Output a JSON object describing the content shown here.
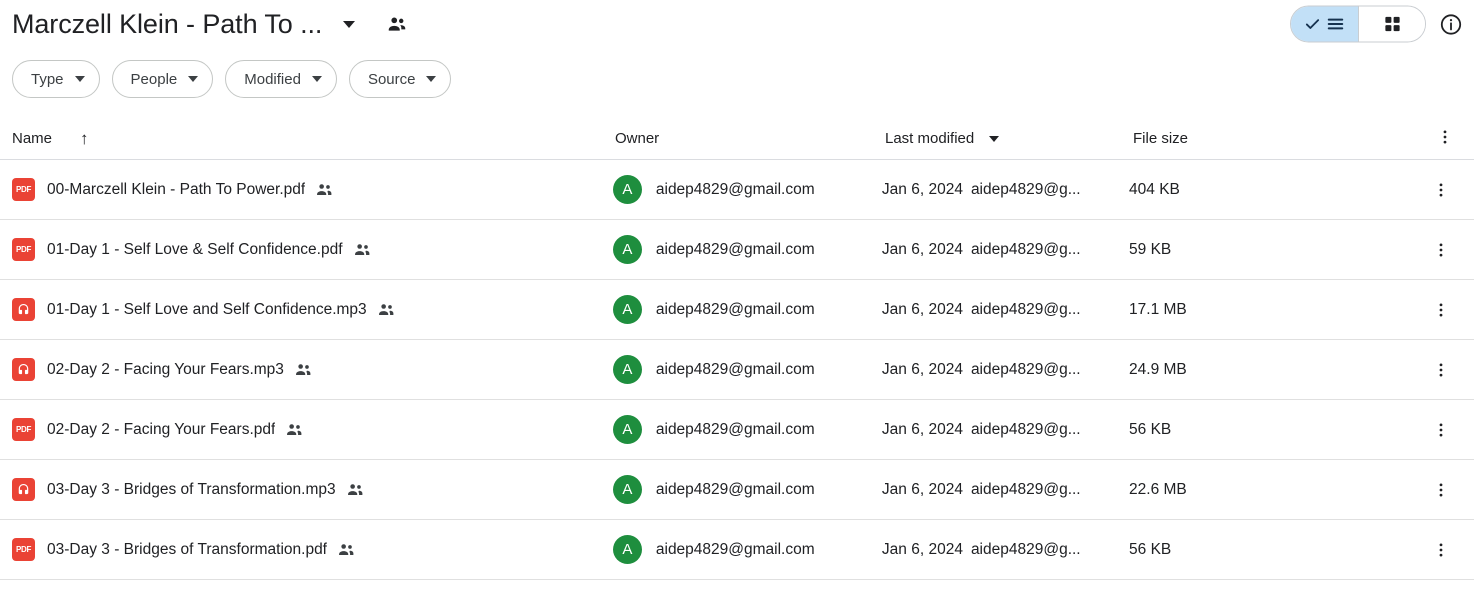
{
  "header": {
    "folder_title": "Marczell Klein - Path To ...",
    "title_caret_icon": "chevron-down-icon",
    "share_icon": "people-shared-icon",
    "view_list_icon": "list-view-icon",
    "view_grid_icon": "grid-view-icon",
    "info_icon": "info-icon",
    "active_view": "list"
  },
  "filters": [
    {
      "label": "Type"
    },
    {
      "label": "People"
    },
    {
      "label": "Modified"
    },
    {
      "label": "Source"
    }
  ],
  "columns": {
    "name": "Name",
    "sort_arrow": "↑",
    "owner": "Owner",
    "last_modified": "Last modified",
    "file_size": "File size",
    "menu_icon": "more-vert-icon"
  },
  "files": [
    {
      "icon": "pdf-file-icon",
      "icon_label": "PDF",
      "name": "00-Marczell Klein - Path To Power.pdf",
      "shared": "people-shared-icon",
      "owner_initial": "A",
      "owner": "aidep4829@gmail.com",
      "modified_date": "Jan 6, 2024",
      "modified_by": "aidep4829@g...",
      "size": "404 KB"
    },
    {
      "icon": "pdf-file-icon",
      "icon_label": "PDF",
      "name": "01-Day 1 - Self Love & Self Confidence.pdf",
      "shared": "people-shared-icon",
      "owner_initial": "A",
      "owner": "aidep4829@gmail.com",
      "modified_date": "Jan 6, 2024",
      "modified_by": "aidep4829@g...",
      "size": "59 KB"
    },
    {
      "icon": "audio-file-icon",
      "icon_label": "",
      "name": "01-Day 1 - Self Love and Self Confidence.mp3",
      "shared": "people-shared-icon",
      "owner_initial": "A",
      "owner": "aidep4829@gmail.com",
      "modified_date": "Jan 6, 2024",
      "modified_by": "aidep4829@g...",
      "size": "17.1 MB"
    },
    {
      "icon": "audio-file-icon",
      "icon_label": "",
      "name": "02-Day 2 - Facing Your Fears.mp3",
      "shared": "people-shared-icon",
      "owner_initial": "A",
      "owner": "aidep4829@gmail.com",
      "modified_date": "Jan 6, 2024",
      "modified_by": "aidep4829@g...",
      "size": "24.9 MB"
    },
    {
      "icon": "pdf-file-icon",
      "icon_label": "PDF",
      "name": "02-Day 2 - Facing Your Fears.pdf",
      "shared": "people-shared-icon",
      "owner_initial": "A",
      "owner": "aidep4829@gmail.com",
      "modified_date": "Jan 6, 2024",
      "modified_by": "aidep4829@g...",
      "size": "56 KB"
    },
    {
      "icon": "audio-file-icon",
      "icon_label": "",
      "name": "03-Day 3 - Bridges of Transformation.mp3",
      "shared": "people-shared-icon",
      "owner_initial": "A",
      "owner": "aidep4829@gmail.com",
      "modified_date": "Jan 6, 2024",
      "modified_by": "aidep4829@g...",
      "size": "22.6 MB"
    },
    {
      "icon": "pdf-file-icon",
      "icon_label": "PDF",
      "name": "03-Day 3 - Bridges of Transformation.pdf",
      "shared": "people-shared-icon",
      "owner_initial": "A",
      "owner": "aidep4829@gmail.com",
      "modified_date": "Jan 6, 2024",
      "modified_by": "aidep4829@g...",
      "size": "56 KB"
    }
  ],
  "colors": {
    "file_red": "#ea4335",
    "avatar_green": "#1e8e3e",
    "toggle_active": "#c2e0f7",
    "toggle_icon": "#16324f",
    "divider": "#e0e0e0"
  }
}
